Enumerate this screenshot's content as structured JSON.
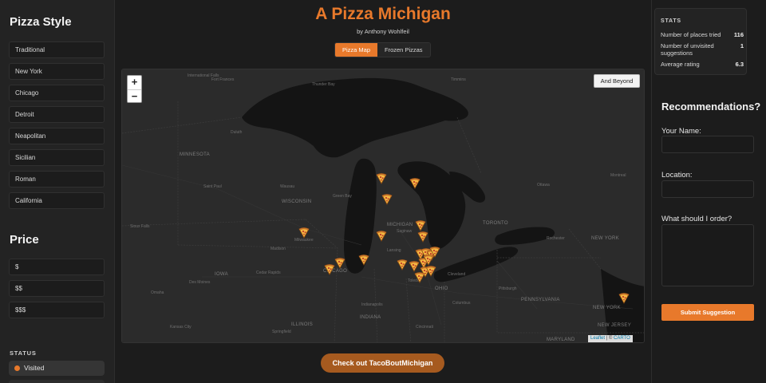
{
  "sidebar": {
    "pizza_style_heading": "Pizza Style",
    "styles": [
      "Traditional",
      "New York",
      "Chicago",
      "Detroit",
      "Neapolitan",
      "Sicilian",
      "Roman",
      "California"
    ],
    "price_heading": "Price",
    "prices": [
      "$",
      "$$",
      "$$$"
    ],
    "status_heading": "STATUS",
    "status_items": [
      {
        "label": "Visited",
        "color": "#e8792b"
      }
    ]
  },
  "header": {
    "title": "A Pizza Michigan",
    "byline": "by Anthony Wohlfeil",
    "tabs": [
      {
        "label": "Pizza Map",
        "active": true
      },
      {
        "label": "Frozen Pizzas",
        "active": false
      }
    ]
  },
  "map": {
    "zoom_in": "+",
    "zoom_out": "−",
    "beyond_button": "And Beyond",
    "attribution_leaflet": "Leaflet",
    "attribution_sep": " | © ",
    "attribution_carto": "CARTO",
    "marker_icon": "pizza-slice-icon",
    "marker_count_visible": 22,
    "labels": {
      "international_falls": "International Falls",
      "fort_frances": "Fort Frances",
      "thunder_bay": "Thunder Bay",
      "timmins": "Timmins",
      "duluth": "Duluth",
      "minnesota": "MINNESOTA",
      "saint_paul": "Saint Paul",
      "wausau": "Wausau",
      "wisconsin": "WISCONSIN",
      "green_bay": "Green Bay",
      "michigan": "MICHIGAN",
      "lansing": "Lansing",
      "saginaw": "Saginaw",
      "toronto": "TORONTO",
      "ottawa": "Ottawa",
      "montreal": "Montreal",
      "new_york_state": "NEW YORK",
      "rochester": "Rochester",
      "iowa": "IOWA",
      "chicago": "CHICAGO",
      "cedar_rapids": "Cedar Rapids",
      "des_moines": "Des Moines",
      "omaha": "Omaha",
      "ohio": "OHIO",
      "cleveland": "Cleveland",
      "columbus": "Columbus",
      "toledo": "Toledo",
      "indiana": "INDIANA",
      "indianapolis": "Indianapolis",
      "illinois": "ILLINOIS",
      "springfield": "Springfield",
      "pennsylvania": "PENNSYLVANIA",
      "maryland": "MARYLAND",
      "new_york_city": "NEW YORK",
      "new_jersey": "NEW JERSEY",
      "milwaukee": "Milwaukee",
      "madison": "Madison",
      "pittsburgh": "Pittsburgh",
      "sioux_falls": "Sioux Falls",
      "kansas_city": "Kansas City",
      "cincinnati": "Cincinnati"
    }
  },
  "cta": {
    "taco_label": "Check out TacoBoutMichigan"
  },
  "stats": {
    "heading": "STATS",
    "rows": [
      {
        "label": "Number of places tried",
        "value": "116"
      },
      {
        "label": "Number of unvisited suggestions",
        "value": "1"
      },
      {
        "label": "Average rating",
        "value": "6.3"
      }
    ]
  },
  "recommend": {
    "heading": "Recommendations?",
    "name_label": "Your Name:",
    "name_value": "",
    "location_label": "Location:",
    "location_value": "",
    "order_label": "What should I order?",
    "order_value": "",
    "submit_label": "Submit Suggestion"
  },
  "colors": {
    "accent": "#e8792b",
    "background": "#1c1c1c",
    "map_water": "#141414",
    "map_land": "#2b2b2b"
  }
}
